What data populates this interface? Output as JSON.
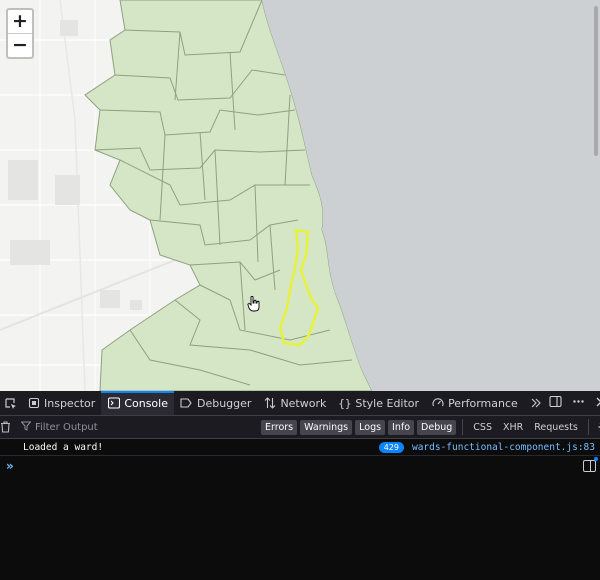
{
  "map": {
    "zoom_in": "+",
    "zoom_out": "−",
    "colors": {
      "land": "#f3f3f1",
      "wards": "#d4e6c6",
      "ward_lines": "#8fa07e",
      "lake": "#cdd0d2",
      "highlight": "#e8f23a"
    }
  },
  "devtools": {
    "tabs": [
      {
        "label": "Inspector",
        "icon": "inspector-icon"
      },
      {
        "label": "Console",
        "icon": "console-icon"
      },
      {
        "label": "Debugger",
        "icon": "debugger-icon"
      },
      {
        "label": "Network",
        "icon": "network-icon"
      },
      {
        "label": "Style Editor",
        "icon": "style-editor-icon"
      },
      {
        "label": "Performance",
        "icon": "performance-icon"
      }
    ],
    "active_tab": "Console",
    "filter_placeholder": "Filter Output",
    "levels": [
      "Errors",
      "Warnings",
      "Logs",
      "Info",
      "Debug"
    ],
    "extra_filters": [
      "CSS",
      "XHR",
      "Requests"
    ],
    "messages": [
      {
        "text": "Loaded a ward!",
        "count": "429",
        "location": "wards-functional-component.js:83"
      }
    ],
    "prompt": "»"
  }
}
